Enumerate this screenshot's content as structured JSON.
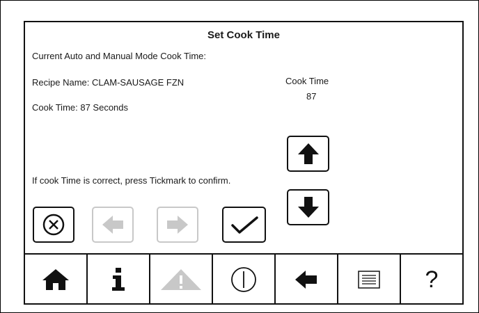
{
  "screen": {
    "title": "Set Cook Time",
    "subtitle": "Current Auto and Manual Mode Cook Time:",
    "recipe_name": "Recipe Name: CLAM-SAUSAGE FZN",
    "cook_time_text": "Cook Time: 87 Seconds",
    "cook_time_label": "Cook Time",
    "cook_time_value": "87",
    "instruction": "If cook Time is correct, press Tickmark to confirm."
  },
  "buttons": {
    "cancel": "cancel-icon",
    "prev": "arrow-left-icon",
    "next": "arrow-right-icon",
    "confirm": "checkmark-icon",
    "increase": "arrow-up-icon",
    "decrease": "arrow-down-icon"
  },
  "navbar": {
    "home": "home-icon",
    "info": "info-icon",
    "warning": "warning-icon",
    "power": "power-icon",
    "back": "back-arrow-icon",
    "menu": "list-icon",
    "help_label": "?"
  },
  "colors": {
    "active": "#111111",
    "disabled": "#c8c8c8",
    "warning_disabled": "#c8c8c8"
  }
}
